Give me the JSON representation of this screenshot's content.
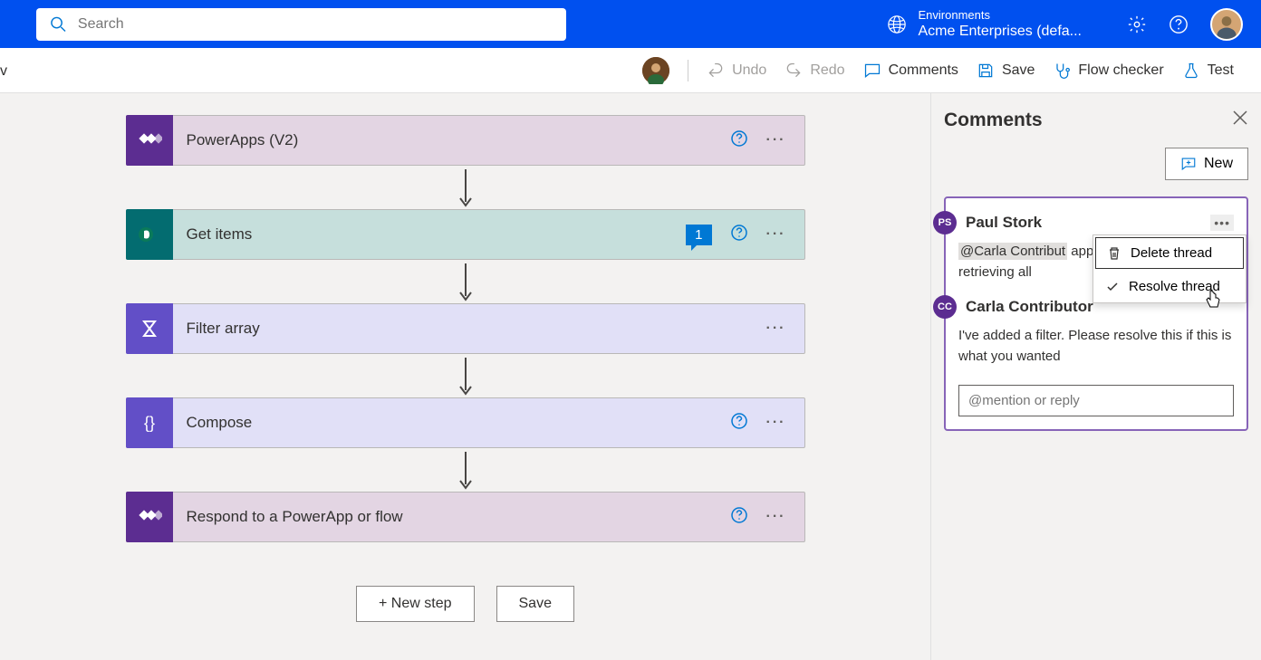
{
  "header": {
    "search_placeholder": "Search",
    "env_label": "Environments",
    "env_name": "Acme Enterprises (defa..."
  },
  "toolbar": {
    "undo": "Undo",
    "redo": "Redo",
    "comments": "Comments",
    "save": "Save",
    "flow_checker": "Flow checker",
    "test": "Test"
  },
  "steps": [
    {
      "title": "PowerApps (V2)",
      "type": "purple",
      "has_help": true,
      "has_badge": false
    },
    {
      "title": "Get items",
      "type": "teal",
      "has_help": true,
      "has_badge": true,
      "badge_count": "1"
    },
    {
      "title": "Filter array",
      "type": "lavender",
      "has_help": false,
      "has_badge": false
    },
    {
      "title": "Compose",
      "type": "lavender",
      "has_help": true,
      "has_badge": false
    },
    {
      "title": "Respond to a PowerApp or flow",
      "type": "purple",
      "has_help": true,
      "has_badge": false
    }
  ],
  "buttons": {
    "new_step": "+ New step",
    "save": "Save"
  },
  "panel": {
    "title": "Comments",
    "new_btn": "New"
  },
  "thread": {
    "author1": "Paul Stork",
    "author1_initials": "PS",
    "body1_mention": "@Carla Contribut",
    "body1_text": " appropriate filter t from retrieving all",
    "author2": "Carla Contributor",
    "author2_initials": "CC",
    "body2": "I've added a filter. Please resolve this if this is what you wanted",
    "reply_placeholder": "@mention or reply"
  },
  "menu": {
    "delete": "Delete thread",
    "resolve": "Resolve thread"
  },
  "partial": "v"
}
